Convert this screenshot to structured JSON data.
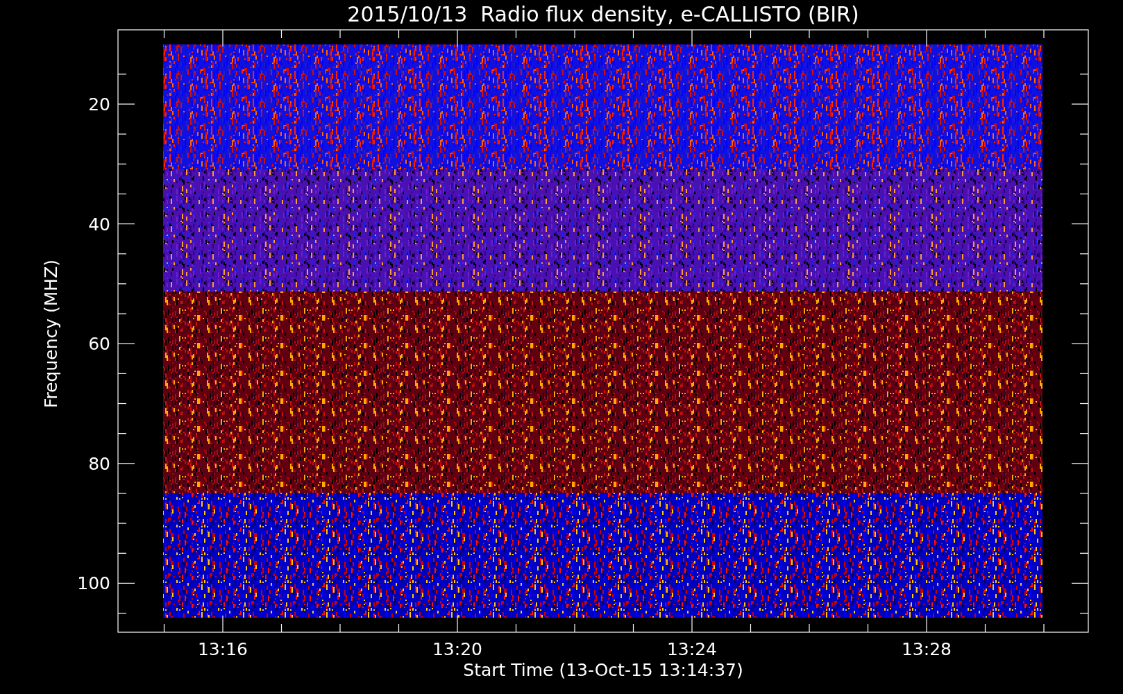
{
  "title": "2015/10/13  Radio flux density, e-CALLISTO (BIR)",
  "y_axis": {
    "label": "Frequency (MHZ)",
    "ticks": [
      "20",
      "40",
      "60",
      "80",
      "100"
    ]
  },
  "x_axis": {
    "label": "Start Time (13-Oct-15 13:14:37)",
    "ticks": [
      "13:16",
      "13:20",
      "13:24",
      "13:28"
    ]
  }
}
